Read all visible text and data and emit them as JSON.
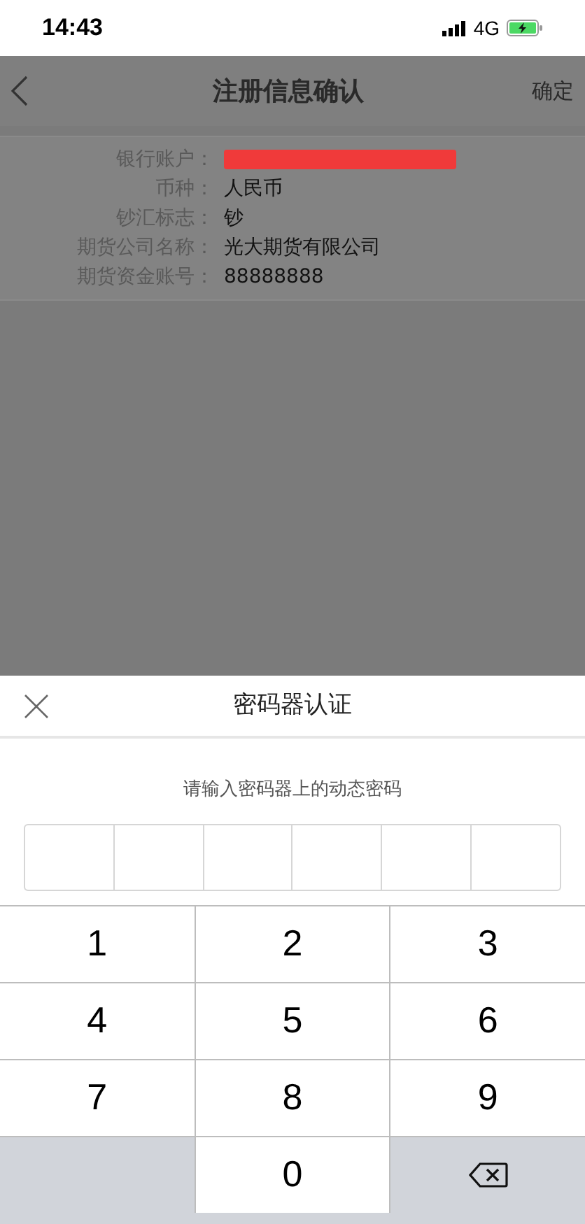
{
  "status_bar": {
    "time": "14:43",
    "network": "4G"
  },
  "nav": {
    "title": "注册信息确认",
    "action": "确定"
  },
  "details": [
    {
      "label": "银行账户：",
      "kind": "redacted"
    },
    {
      "label": "币种：",
      "kind": "text",
      "value": "人民币"
    },
    {
      "label": "钞汇标志：",
      "kind": "text",
      "value": "钞"
    },
    {
      "label": "期货公司名称：",
      "kind": "text",
      "value": "光大期货有限公司"
    },
    {
      "label": "期货资金账号：",
      "kind": "text",
      "value": "88888888"
    }
  ],
  "dialog": {
    "title": "密码器认证",
    "prompt": "请输入密码器上的动态密码",
    "code_cells": [
      {
        "filled": false
      },
      {
        "filled": false
      },
      {
        "filled": false
      },
      {
        "filled": false
      },
      {
        "filled": false
      },
      {
        "filled": false
      }
    ]
  },
  "keypad": [
    {
      "kind": "digit",
      "label": "1"
    },
    {
      "kind": "digit",
      "label": "2"
    },
    {
      "kind": "digit",
      "label": "3"
    },
    {
      "kind": "digit",
      "label": "4"
    },
    {
      "kind": "digit",
      "label": "5"
    },
    {
      "kind": "digit",
      "label": "6"
    },
    {
      "kind": "digit",
      "label": "7"
    },
    {
      "kind": "digit",
      "label": "8"
    },
    {
      "kind": "digit",
      "label": "9"
    },
    {
      "kind": "blank"
    },
    {
      "kind": "digit",
      "label": "0"
    },
    {
      "kind": "delete"
    }
  ]
}
